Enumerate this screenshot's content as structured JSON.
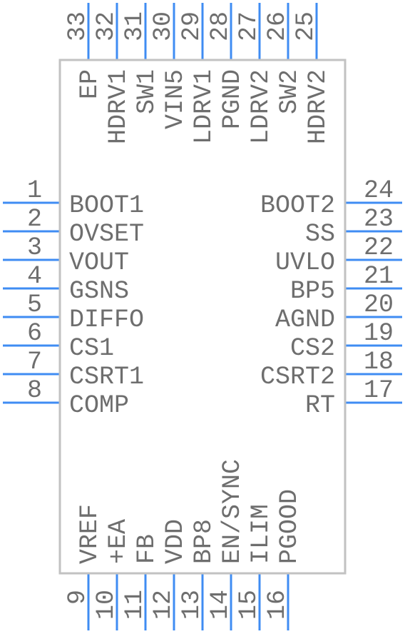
{
  "colors": {
    "pin": "#3f8cf3",
    "body": "#c2c2c2",
    "text": "#6e6e6e"
  },
  "pins": {
    "left": [
      {
        "num": "1",
        "name": "BOOT1"
      },
      {
        "num": "2",
        "name": "OVSET"
      },
      {
        "num": "3",
        "name": "VOUT"
      },
      {
        "num": "4",
        "name": "GSNS"
      },
      {
        "num": "5",
        "name": "DIFFO"
      },
      {
        "num": "6",
        "name": "CS1"
      },
      {
        "num": "7",
        "name": "CSRT1"
      },
      {
        "num": "8",
        "name": "COMP"
      }
    ],
    "right": [
      {
        "num": "24",
        "name": "BOOT2"
      },
      {
        "num": "23",
        "name": "SS"
      },
      {
        "num": "22",
        "name": "UVLO"
      },
      {
        "num": "21",
        "name": "BP5"
      },
      {
        "num": "20",
        "name": "AGND"
      },
      {
        "num": "19",
        "name": "CS2"
      },
      {
        "num": "18",
        "name": "CSRT2"
      },
      {
        "num": "17",
        "name": "RT"
      }
    ],
    "top": [
      {
        "num": "33",
        "name": "EP"
      },
      {
        "num": "32",
        "name": "HDRV1"
      },
      {
        "num": "31",
        "name": "SW1"
      },
      {
        "num": "30",
        "name": "VIN5"
      },
      {
        "num": "29",
        "name": "LDRV1"
      },
      {
        "num": "28",
        "name": "PGND"
      },
      {
        "num": "27",
        "name": "LDRV2"
      },
      {
        "num": "26",
        "name": "SW2"
      },
      {
        "num": "25",
        "name": "HDRV2"
      }
    ],
    "bottom": [
      {
        "num": "9",
        "name": "VREF"
      },
      {
        "num": "10",
        "name": "+EA"
      },
      {
        "num": "11",
        "name": "FB"
      },
      {
        "num": "12",
        "name": "VDD"
      },
      {
        "num": "13",
        "name": "BP8"
      },
      {
        "num": "14",
        "name": "EN/SYNC"
      },
      {
        "num": "15",
        "name": "ILIM"
      },
      {
        "num": "16",
        "name": "PGOOD"
      }
    ]
  }
}
